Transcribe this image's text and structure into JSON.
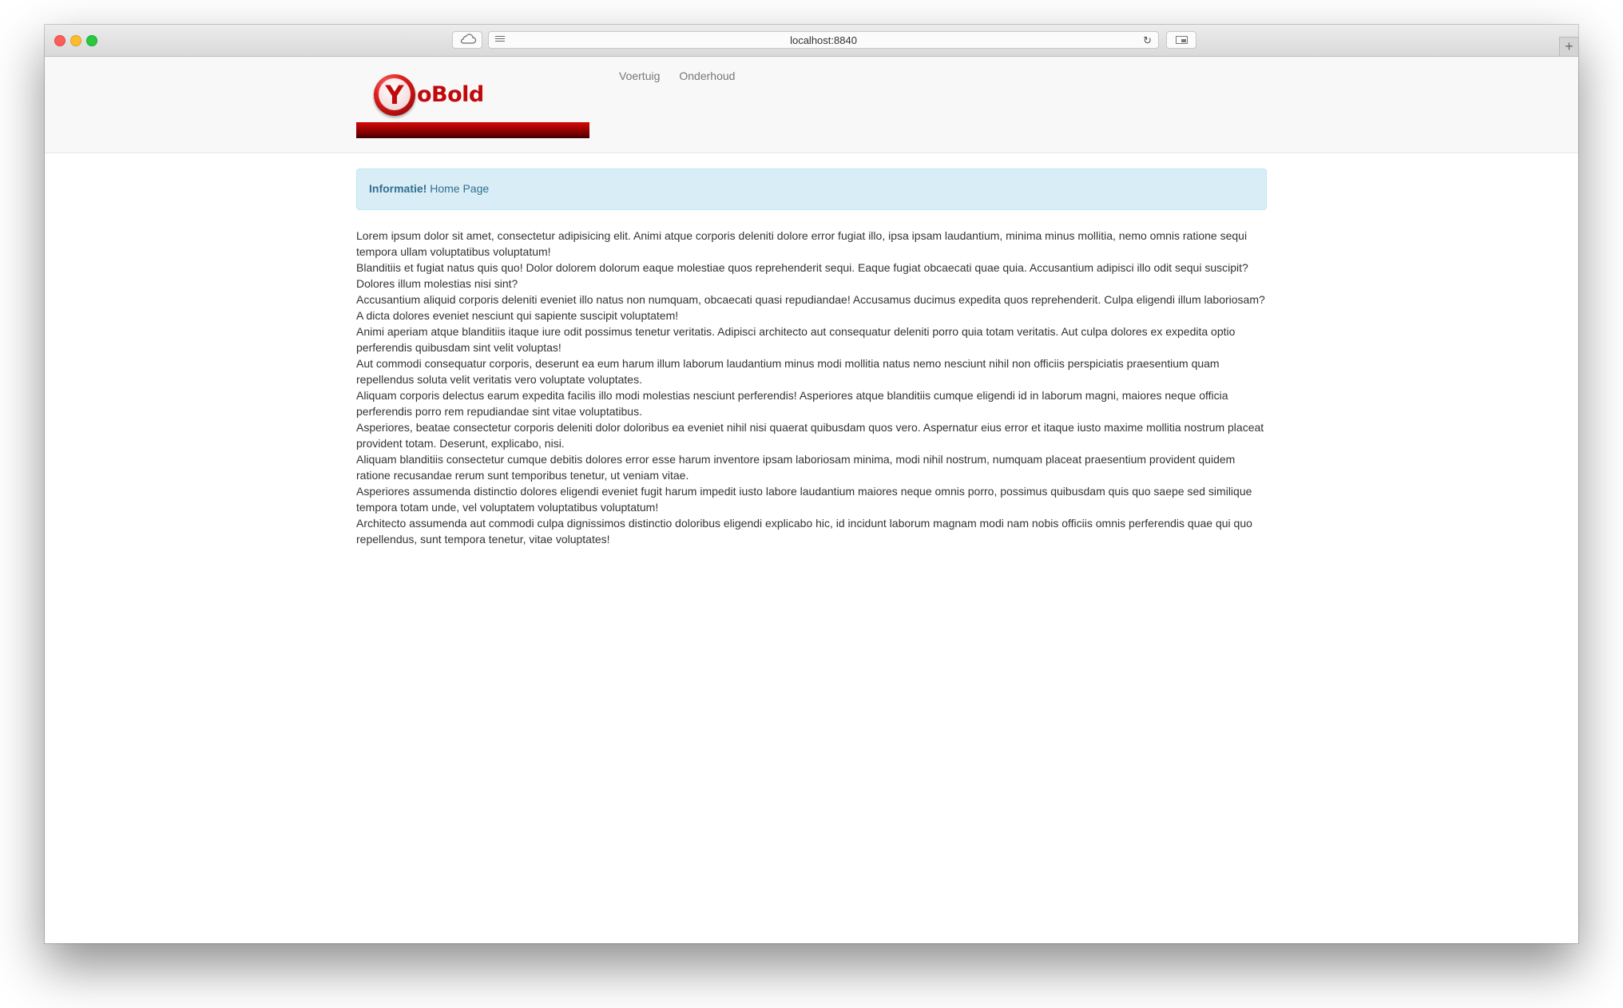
{
  "browser": {
    "url": "localhost:8840",
    "newtab_label": "+"
  },
  "brand": {
    "logo_letter": "Y",
    "logo_text": "oBold"
  },
  "nav": {
    "items": [
      {
        "label": "Voertuig"
      },
      {
        "label": "Onderhoud"
      }
    ]
  },
  "alert": {
    "strong": "Informatie!",
    "text": " Home Page"
  },
  "body": {
    "paragraphs": [
      "Lorem ipsum dolor sit amet, consectetur adipisicing elit. Animi atque corporis deleniti dolore error fugiat illo, ipsa ipsam laudantium, minima minus mollitia, nemo omnis ratione sequi tempora ullam voluptatibus voluptatum!",
      "Blanditiis et fugiat natus quis quo! Dolor dolorem dolorum eaque molestiae quos reprehenderit sequi. Eaque fugiat obcaecati quae quia. Accusantium adipisci illo odit sequi suscipit? Dolores illum molestias nisi sint?",
      "Accusantium aliquid corporis deleniti eveniet illo natus non numquam, obcaecati quasi repudiandae! Accusamus ducimus expedita quos reprehenderit. Culpa eligendi illum laboriosam? A dicta dolores eveniet nesciunt qui sapiente suscipit voluptatem!",
      "Animi aperiam atque blanditiis itaque iure odit possimus tenetur veritatis. Adipisci architecto aut consequatur deleniti porro quia totam veritatis. Aut culpa dolores ex expedita optio perferendis quibusdam sint velit voluptas!",
      "Aut commodi consequatur corporis, deserunt ea eum harum illum laborum laudantium minus modi mollitia natus nemo nesciunt nihil non officiis perspiciatis praesentium quam repellendus soluta velit veritatis vero voluptate voluptates.",
      "Aliquam corporis delectus earum expedita facilis illo modi molestias nesciunt perferendis! Asperiores atque blanditiis cumque eligendi id in laborum magni, maiores neque officia perferendis porro rem repudiandae sint vitae voluptatibus.",
      "Asperiores, beatae consectetur corporis deleniti dolor doloribus ea eveniet nihil nisi quaerat quibusdam quos vero. Aspernatur eius error et itaque iusto maxime mollitia nostrum placeat provident totam. Deserunt, explicabo, nisi.",
      "Aliquam blanditiis consectetur cumque debitis dolores error esse harum inventore ipsam laboriosam minima, modi nihil nostrum, numquam placeat praesentium provident quidem ratione recusandae rerum sunt temporibus tenetur, ut veniam vitae.",
      "Asperiores assumenda distinctio dolores eligendi eveniet fugit harum impedit iusto labore laudantium maiores neque omnis porro, possimus quibusdam quis quo saepe sed similique tempora totam unde, vel voluptatem voluptatibus voluptatum!",
      "Architecto assumenda aut commodi culpa dignissimos distinctio doloribus eligendi explicabo hic, id incidunt laborum magnam modi nam nobis officiis omnis perferendis quae qui quo repellendus, sunt tempora tenetur, vitae voluptates!"
    ]
  },
  "colors": {
    "alert_bg": "#d9edf7",
    "alert_text": "#31708f",
    "brand_red": "#c1090b",
    "navbar_bg": "#f8f8f8"
  }
}
